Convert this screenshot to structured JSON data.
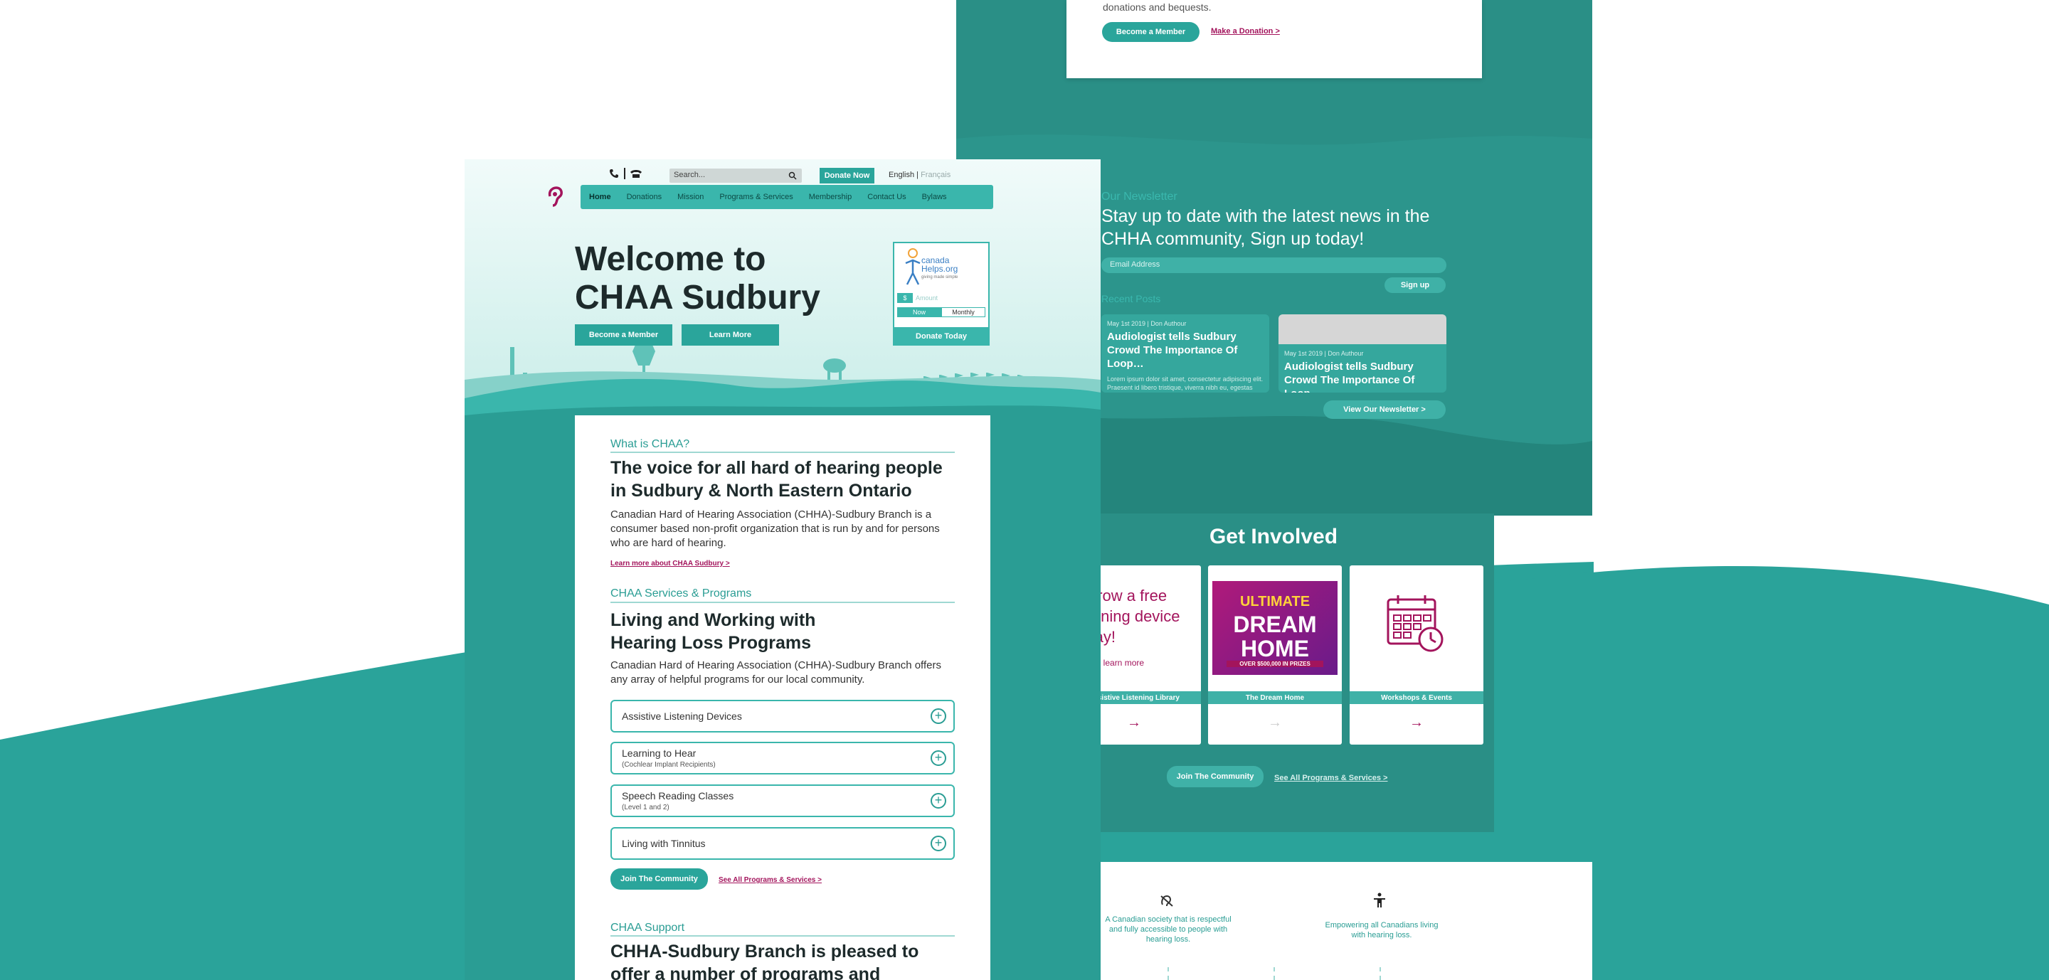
{
  "back_top": {
    "text": "donations and bequests.",
    "become_member": "Become a Member",
    "make_donation": "Make a Donation >"
  },
  "newsletter": {
    "kicker": "Our Newsletter",
    "title": "Stay up to date with the latest news in the CHHA community, Sign up today!",
    "email_placeholder": "Email Address",
    "signup": "Sign up",
    "recent_kicker": "Recent Posts",
    "posts": [
      {
        "meta": "May 1st 2019 | Don Authour",
        "title": "Audiologist tells Sudbury Crowd The Importance Of Loop…",
        "body": "Lorem ipsum dolor sit amet, consectetur adipiscing elit. Praesent id libero tristique, viverra nibh eu, egestas turpis…"
      },
      {
        "meta": "May 1st 2019 | Don Authour",
        "title": "Audiologist tells Sudbury Crowd The Importance Of Loop…",
        "body": ""
      }
    ],
    "view_newsletter": "View Our Newsletter >"
  },
  "get_involved": {
    "title": "Get Involved",
    "borrow_text": "Borrow a free listening device today!",
    "click_text": "Click to learn more",
    "cards": [
      {
        "label": "Assistive Listening Library"
      },
      {
        "label": "The Dream Home"
      },
      {
        "label": "Workshops & Events"
      }
    ],
    "dream_home": {
      "top": "ULTIMATE",
      "main": "DREAM HOME",
      "banner": "OVER $500,000 IN PRIZES"
    },
    "arrow": "→",
    "join": "Join The Community",
    "see_all": "See All Programs & Services >"
  },
  "mission_vision": [
    "A Canadian society that is respectful and fully accessible to people with hearing loss.",
    "Empowering all Canadians living with hearing loss."
  ],
  "front": {
    "search_placeholder": "Search...",
    "donate_now": "Donate Now",
    "lang_en": "English",
    "lang_sep": " | ",
    "lang_fr": "Français",
    "nav": [
      "Home",
      "Donations",
      "Mission",
      "Programs & Services",
      "Membership",
      "Contact Us",
      "Bylaws"
    ],
    "hero_title_1": "Welcome to",
    "hero_title_2": "CHAA Sudbury",
    "become_member": "Become a Member",
    "learn_more": "Learn More",
    "widget": {
      "brand_1": "canada",
      "brand_2": "Helps.org",
      "brand_3": "giving made simple",
      "currency": "$",
      "amount_placeholder": "Amount",
      "now": "Now",
      "monthly": "Monthly",
      "donate_today": "Donate Today"
    }
  },
  "content": {
    "what_kicker": "What is CHAA?",
    "what_title": "The voice for all hard of hearing people in Sudbury & North Eastern Ontario",
    "what_body": "Canadian Hard of Hearing Association (CHHA)-Sudbury Branch is a consumer based non-profit organization that is run by and for persons who are hard of hearing.",
    "what_link": "Learn more about CHAA Sudbury >",
    "services_kicker": "CHAA Services & Programs",
    "services_title": "Living and Working with Hearing Loss Programs",
    "services_body": "Canadian Hard of Hearing Association (CHHA)-Sudbury Branch offers any array of helpful programs for our local community.",
    "accordion": [
      {
        "label": "Assistive Listening Devices",
        "sub": ""
      },
      {
        "label": "Learning to Hear",
        "sub": "(Cochlear Implant Recipients)"
      },
      {
        "label": "Speech Reading Classes",
        "sub": "(Level 1 and 2)"
      },
      {
        "label": "Living with Tinnitus",
        "sub": ""
      }
    ],
    "join": "Join The Community",
    "see_all": "See All Programs & Services >",
    "support_kicker": "CHAA Support",
    "support_title": "CHHA-Sudbury Branch is pleased to offer a number of programs and"
  },
  "colors": {
    "teal": "#2a9d94",
    "dark_teal": "#2a8f86",
    "magenta": "#a3145c",
    "bright_teal": "#3ab6ac"
  }
}
